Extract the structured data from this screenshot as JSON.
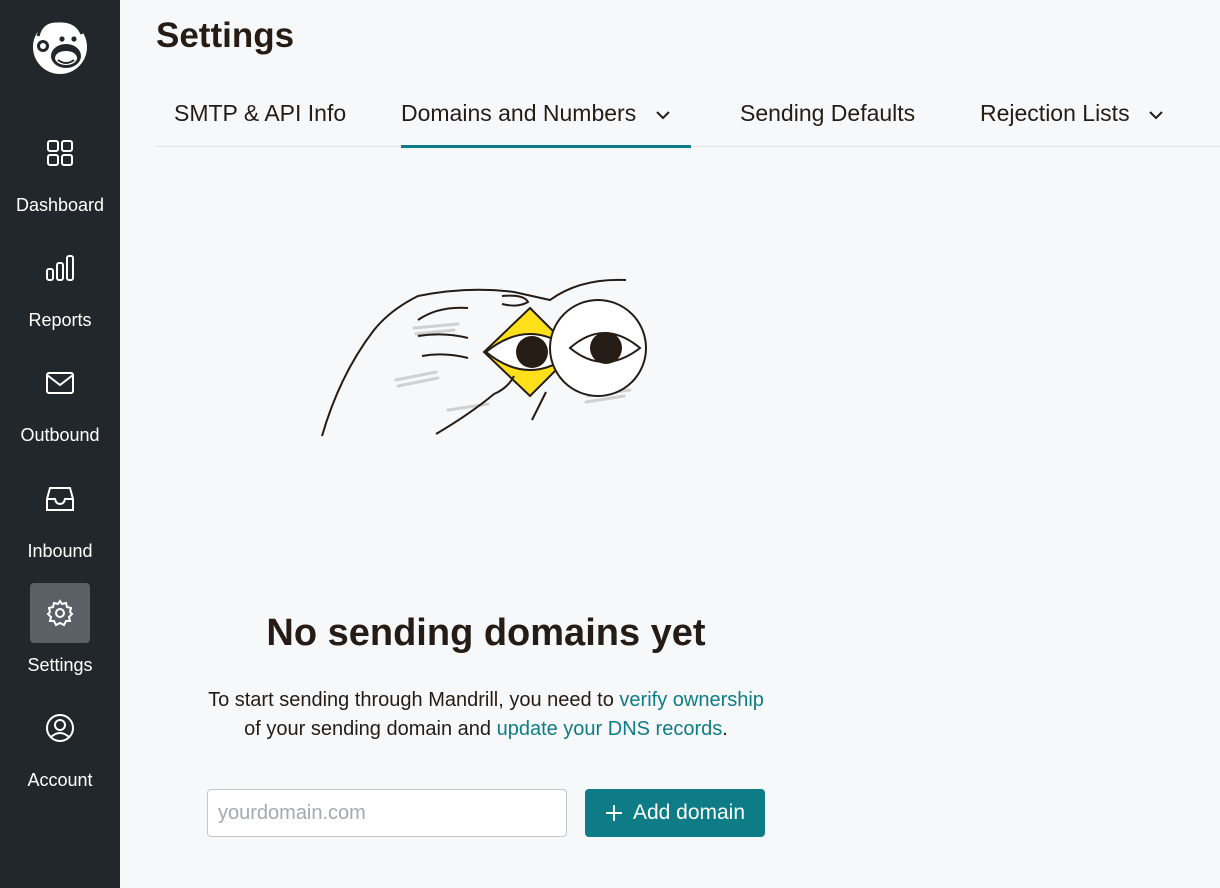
{
  "sidebar": {
    "items": [
      {
        "label": "Dashboard",
        "icon": "grid-icon"
      },
      {
        "label": "Reports",
        "icon": "bar-chart-icon"
      },
      {
        "label": "Outbound",
        "icon": "envelope-icon"
      },
      {
        "label": "Inbound",
        "icon": "inbox-icon"
      },
      {
        "label": "Settings",
        "icon": "gear-icon",
        "active": true
      },
      {
        "label": "Account",
        "icon": "user-circle-icon"
      }
    ]
  },
  "header": {
    "title": "Settings"
  },
  "tabs": [
    {
      "label": "SMTP & API Info"
    },
    {
      "label": "Domains and Numbers",
      "active": true,
      "has_dropdown": true
    },
    {
      "label": "Sending Defaults"
    },
    {
      "label": "Rejection Lists",
      "has_dropdown": true
    }
  ],
  "empty_state": {
    "title": "No sending domains yet",
    "text_1": "To start sending through Mandrill, you need to ",
    "link_1": "verify ownership",
    "text_2": "of your sending domain and ",
    "link_2": "update your DNS records",
    "text_3": "."
  },
  "form": {
    "placeholder": "yourdomain.com",
    "add_label": "Add domain"
  },
  "colors": {
    "accent": "#0e7c86",
    "sidebar_bg": "#22272b",
    "highlight_yellow": "#ffe01b"
  }
}
